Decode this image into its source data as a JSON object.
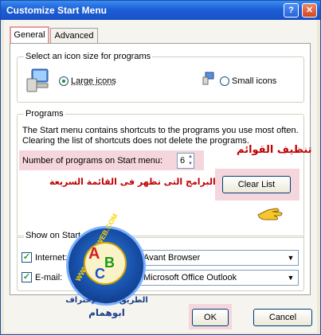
{
  "window": {
    "title": "Customize Start Menu",
    "help_icon": "?",
    "close_icon": "✕"
  },
  "tabs": [
    {
      "label": "General"
    },
    {
      "label": "Advanced"
    }
  ],
  "icon_size": {
    "label": "Select an icon size for programs",
    "large": "Large icons",
    "small": "Small icons",
    "selected": "large"
  },
  "programs": {
    "label": "Programs",
    "description_line1": "The Start menu contains shortcuts to the programs you use most often.",
    "description_line2": "Clearing the list of shortcuts does not delete the programs.",
    "count_label": "Number of programs on Start menu:",
    "count_value": "6",
    "clear_button": "Clear List"
  },
  "show_on_start": {
    "label": "Show on Start menu",
    "internet_label": "Internet:",
    "internet_value": "Avant Browser",
    "internet_checked": true,
    "email_label": "E-mail:",
    "email_value": "Microsoft Office Outlook",
    "email_checked": true
  },
  "annotations": {
    "clear_lists": "تنظيف القوائم",
    "programs_count": "عدد البرامج التى تظهر فى القائمة السريعة"
  },
  "watermark": {
    "site": "WWW.ABC4WEB.COM",
    "letter_a": "A",
    "letter_b": "B",
    "letter_c": "C",
    "tagline": "الطريق الى الإحتراف",
    "author": "ابوهمام"
  },
  "footer": {
    "ok": "OK",
    "cancel": "Cancel"
  },
  "colors": {
    "title_bar": "#1d5fd6",
    "annotation_red": "#c00000",
    "highlight": "#f5d6dd"
  }
}
